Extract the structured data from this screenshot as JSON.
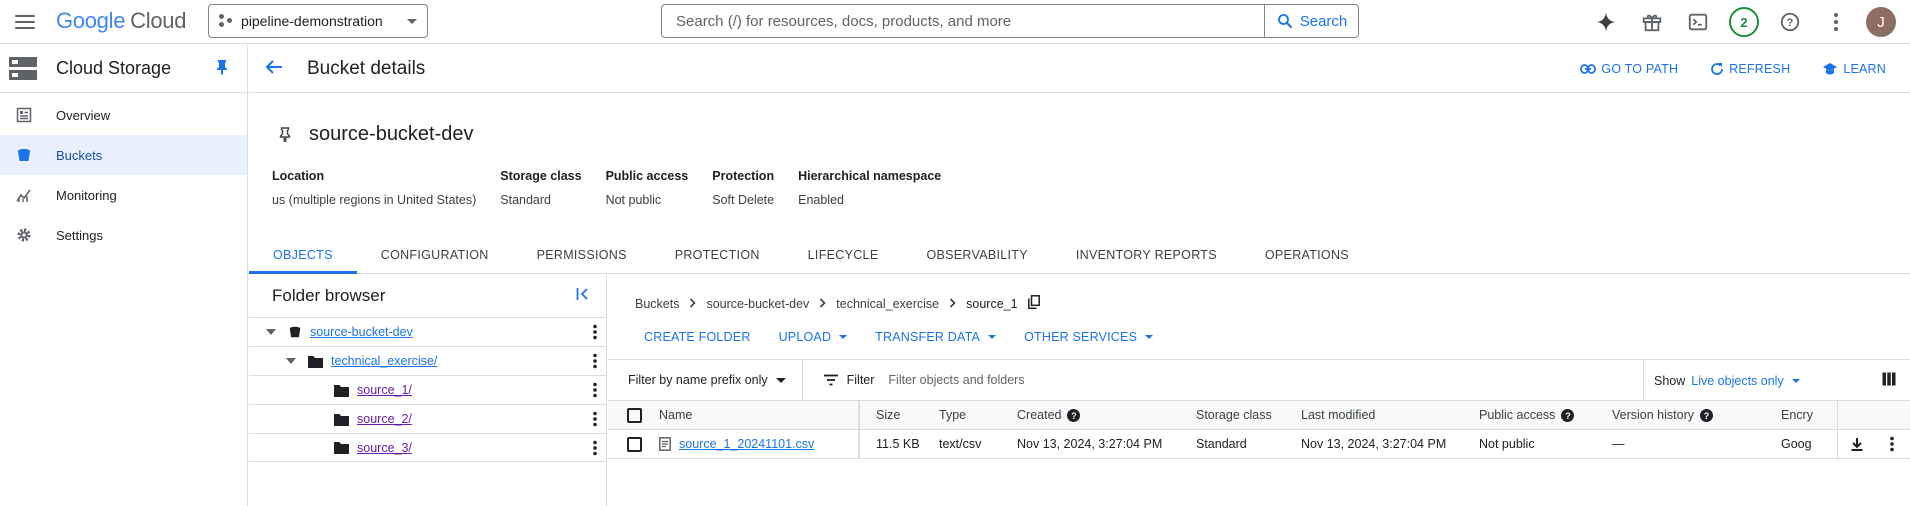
{
  "header": {
    "logo_google": "Google",
    "logo_cloud": "Cloud",
    "project": "pipeline-demonstration",
    "search_placeholder": "Search (/) for resources, docs, products, and more",
    "search_button": "Search",
    "notification_count": "2",
    "avatar_initial": "J"
  },
  "sidebar": {
    "title": "Cloud Storage",
    "items": [
      {
        "label": "Overview",
        "icon": "overview-icon"
      },
      {
        "label": "Buckets",
        "icon": "bucket-icon"
      },
      {
        "label": "Monitoring",
        "icon": "monitoring-icon"
      },
      {
        "label": "Settings",
        "icon": "gear-icon"
      }
    ]
  },
  "page": {
    "title": "Bucket details",
    "actions": {
      "go_to_path": "GO TO PATH",
      "refresh": "REFRESH",
      "learn": "LEARN"
    }
  },
  "bucket": {
    "name": "source-bucket-dev",
    "meta": [
      {
        "key": "Location",
        "value": "us (multiple regions in United States)"
      },
      {
        "key": "Storage class",
        "value": "Standard"
      },
      {
        "key": "Public access",
        "value": "Not public"
      },
      {
        "key": "Protection",
        "value": "Soft Delete"
      },
      {
        "key": "Hierarchical namespace",
        "value": "Enabled"
      }
    ]
  },
  "tabs": [
    "OBJECTS",
    "CONFIGURATION",
    "PERMISSIONS",
    "PROTECTION",
    "LIFECYCLE",
    "OBSERVABILITY",
    "INVENTORY REPORTS",
    "OPERATIONS"
  ],
  "folder_browser": {
    "title": "Folder browser",
    "items": [
      "source-bucket-dev",
      "technical_exercise/",
      "source_1/",
      "source_2/",
      "source_3/"
    ]
  },
  "breadcrumb": [
    "Buckets",
    "source-bucket-dev",
    "technical_exercise",
    "source_1"
  ],
  "toolbar": {
    "create_folder": "CREATE FOLDER",
    "upload": "UPLOAD",
    "transfer_data": "TRANSFER DATA",
    "other_services": "OTHER SERVICES"
  },
  "filter": {
    "prefix_select": "Filter by name prefix only",
    "filter_label": "Filter",
    "placeholder": "Filter objects and folders",
    "show_label": "Show",
    "show_value": "Live objects only"
  },
  "table": {
    "columns": [
      "Name",
      "Size",
      "Type",
      "Created",
      "Storage class",
      "Last modified",
      "Public access",
      "Version history",
      "Encry"
    ],
    "rows": [
      {
        "name": "source_1_20241101.csv",
        "size": "11.5 KB",
        "type": "text/csv",
        "created": "Nov 13, 2024, 3:27:04 PM",
        "storage_class": "Standard",
        "last_modified": "Nov 13, 2024, 3:27:04 PM",
        "public_access": "Not public",
        "version_history": "—",
        "encryption": "Goog"
      }
    ]
  },
  "colors": {
    "accent": "#1a73e8",
    "active_bg": "#e8f0fe",
    "border": "#dadce0",
    "visited": "#681da8"
  }
}
